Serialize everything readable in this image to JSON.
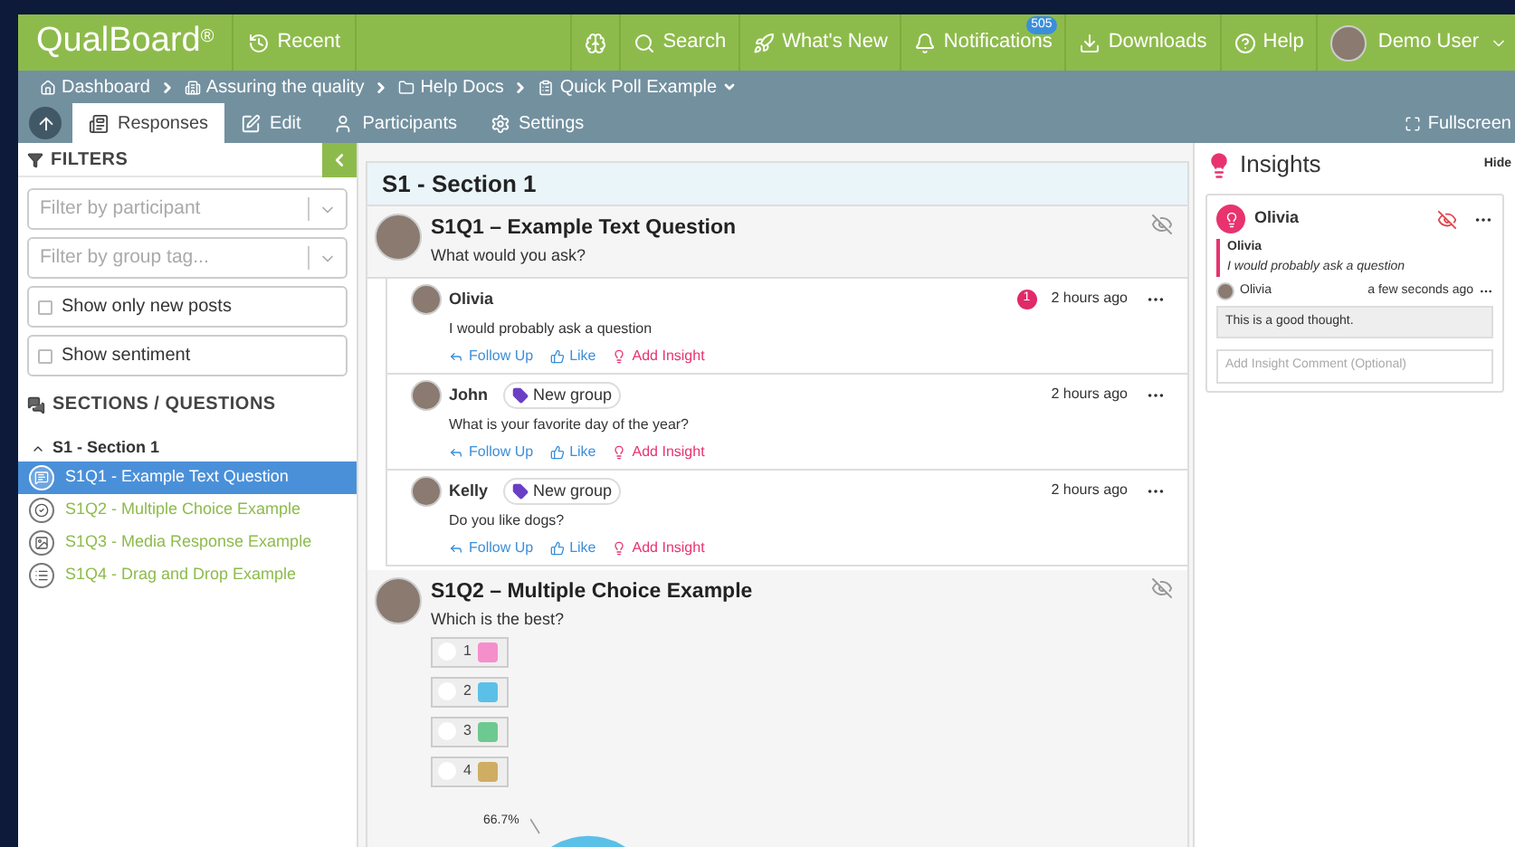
{
  "topbar": {
    "logo": "QualBoard",
    "logo_mark": "®",
    "recent": "Recent",
    "nav": [
      {
        "kind": "brain"
      },
      {
        "kind": "search",
        "label": "Search"
      },
      {
        "kind": "rocket",
        "label": "What's New"
      },
      {
        "kind": "bell",
        "label": "Notifications",
        "badge": "505"
      },
      {
        "kind": "download",
        "label": "Downloads"
      },
      {
        "kind": "help",
        "label": "Help"
      }
    ],
    "user": "Demo User"
  },
  "breadcrumb": [
    {
      "kind": "home",
      "label": "Dashboard"
    },
    {
      "kind": "building",
      "label": "Assuring the quality"
    },
    {
      "kind": "folder",
      "label": "Help Docs"
    },
    {
      "kind": "clipboard",
      "label": "Quick Poll Example"
    }
  ],
  "tabs": [
    {
      "kind": "responses",
      "label": "Responses",
      "selected": true
    },
    {
      "kind": "edit",
      "label": "Edit",
      "selected": false
    },
    {
      "kind": "participants",
      "label": "Participants",
      "selected": false
    },
    {
      "kind": "settings",
      "label": "Settings",
      "selected": false
    }
  ],
  "fullscreen": "Fullscreen",
  "filters": {
    "title": "FILTERS",
    "selects": [
      {
        "placeholder": "Filter by participant"
      },
      {
        "placeholder": "Filter by group tag..."
      }
    ],
    "checks": [
      {
        "label": "Show only new posts",
        "checked": false
      },
      {
        "label": "Show sentiment",
        "checked": false
      }
    ]
  },
  "sections": {
    "title": "SECTIONS / QUESTIONS",
    "section": {
      "label": "S1 - Section 1",
      "expanded": true,
      "children": [
        {
          "kind": "text",
          "label": "S1Q1 - Example Text Question",
          "selected": true
        },
        {
          "kind": "choice",
          "label": "S1Q2 - Multiple Choice Example",
          "selected": false
        },
        {
          "kind": "media",
          "label": "S1Q3 - Media Response Example",
          "selected": false
        },
        {
          "kind": "list",
          "label": "S1Q4 - Drag and Drop Example",
          "selected": false
        }
      ]
    }
  },
  "main": {
    "section_title": "S1 - Section 1",
    "q1": {
      "title": "S1Q1 – Example Text Question",
      "prompt": "What would you ask?"
    },
    "posts": [
      {
        "name": "Olivia",
        "badge": "1",
        "time": "2 hours ago",
        "text": "I would probably ask a question",
        "actions": [
          {
            "kind": "reply",
            "label": "Follow Up"
          },
          {
            "kind": "like",
            "label": "Like"
          },
          {
            "kind": "insight",
            "label": "Add Insight"
          }
        ]
      },
      {
        "name": "John",
        "tag": "New group",
        "time": "2 hours ago",
        "text": "What is your favorite day of the year?",
        "actions": [
          {
            "kind": "reply",
            "label": "Follow Up"
          },
          {
            "kind": "like",
            "label": "Like"
          },
          {
            "kind": "insight",
            "label": "Add Insight"
          }
        ]
      },
      {
        "name": "Kelly",
        "tag": "New group",
        "time": "2 hours ago",
        "text": "Do you like dogs?",
        "actions": [
          {
            "kind": "reply",
            "label": "Follow Up"
          },
          {
            "kind": "like",
            "label": "Like"
          },
          {
            "kind": "insight",
            "label": "Add Insight"
          }
        ]
      }
    ],
    "q2": {
      "title": "S1Q2 – Multiple Choice Example",
      "prompt": "Which is the best?",
      "options": [
        {
          "label": "1",
          "color": "#f48fcb",
          "selected": false
        },
        {
          "label": "2",
          "color": "#5bc0e8",
          "selected": false
        },
        {
          "label": "3",
          "color": "#6cc990",
          "selected": false
        },
        {
          "label": "4",
          "color": "#cfad63",
          "selected": false
        }
      ],
      "pie_label": "66.7%"
    }
  },
  "insights": {
    "title": "Insights",
    "hide": "Hide",
    "card": {
      "name": "Olivia",
      "quote_name": "Olivia",
      "quote": "I would probably ask a question",
      "comment_author": "Olivia",
      "comment_time": "a few seconds ago",
      "comment": "This is a good thought.",
      "placeholder": "Add Insight Comment (Optional)"
    }
  }
}
